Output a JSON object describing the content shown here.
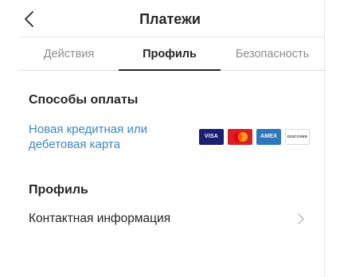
{
  "header": {
    "title": "Платежи"
  },
  "tabs": [
    {
      "label": "Действия",
      "active": false
    },
    {
      "label": "Профиль",
      "active": true
    },
    {
      "label": "Безопасность",
      "active": false
    }
  ],
  "payment_methods": {
    "section_title": "Способы оплаты",
    "add_card_label": "Новая кредитная или дебетовая карта",
    "card_brands": [
      {
        "name": "visa",
        "text": "VISA",
        "color": "#1a1f71"
      },
      {
        "name": "mastercard",
        "text": "",
        "color": "#d81f26"
      },
      {
        "name": "amex",
        "text": "AMEX",
        "color": "#2e77bc"
      },
      {
        "name": "discover",
        "text": "DISCOVER",
        "color": "#ffffff"
      }
    ]
  },
  "profile": {
    "section_title": "Профиль",
    "contact_info_label": "Контактная информация"
  },
  "colors": {
    "link": "#3a88c6",
    "text": "#262626",
    "muted": "#8e8e8e"
  }
}
